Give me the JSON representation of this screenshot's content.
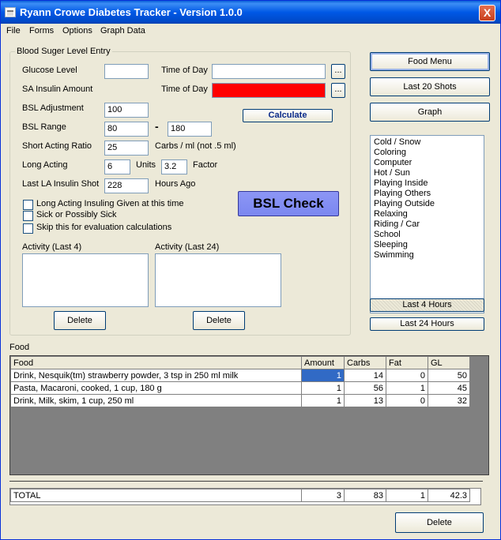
{
  "window": {
    "title": "Ryann Crowe Diabetes Tracker - Version 1.0.0",
    "close": "X"
  },
  "menu": [
    "File",
    "Forms",
    "Options",
    "Graph Data"
  ],
  "entry": {
    "group_title": "Blood Suger Level Entry",
    "glucose_label": "Glucose Level",
    "glucose_value": "",
    "time_of_day_label": "Time of Day",
    "time1_value": "",
    "sa_insulin_label": "SA Insulin Amount",
    "time2_value": "",
    "browse": "...",
    "bsl_adjustment_label": "BSL Adjustment",
    "bsl_adjustment_value": "100",
    "bsl_range_label": "BSL Range",
    "bsl_range_low": "80",
    "range_dash": "-",
    "bsl_range_high": "180",
    "calculate_label": "Calculate",
    "short_acting_label": "Short Acting  Ratio",
    "short_acting_value": "25",
    "carbs_ml_label": "Carbs / ml (not .5 ml)",
    "long_acting_label": "Long Acting",
    "long_acting_value": "6",
    "units_label": "Units",
    "factor_value": "3.2",
    "factor_label": "Factor",
    "last_la_label": "Last LA Insulin Shot",
    "last_la_value": "228",
    "hours_ago_label": "Hours Ago",
    "bsl_check_label": "BSL Check",
    "checkboxes": [
      "Long Acting Insuling Given at this time",
      "Sick or Possibly Sick",
      "Skip this for evaluation calculations"
    ],
    "activity_last4_label": "Activity (Last 4)",
    "activity_last24_label": "Activity (Last 24)",
    "delete_label": "Delete"
  },
  "right": {
    "food_menu": "Food Menu",
    "last20": "Last 20 Shots",
    "graph": "Graph",
    "activities": [
      "Cold / Snow",
      "Coloring",
      "Computer",
      "Hot / Sun",
      "Playing Inside",
      "Playing Others",
      "Playing Outside",
      "Relaxing",
      "Riding / Car",
      "School",
      "Sleeping",
      "Swimming"
    ],
    "last4": "Last 4 Hours",
    "last24": "Last 24 Hours"
  },
  "food": {
    "label": "Food",
    "columns": [
      "Food",
      "Amount",
      "Carbs",
      "Fat",
      "GL"
    ],
    "rows": [
      [
        "Drink, Nesquik(tm) strawberry powder, 3 tsp in 250 ml milk",
        "1",
        "14",
        "0",
        "50"
      ],
      [
        "Pasta, Macaroni, cooked, 1 cup, 180 g",
        "1",
        "56",
        "1",
        "45"
      ],
      [
        "Drink, Milk, skim, 1 cup, 250 ml",
        "1",
        "13",
        "0",
        "32"
      ]
    ],
    "total": [
      "TOTAL",
      "3",
      "83",
      "1",
      "42.3"
    ],
    "delete": "Delete"
  }
}
